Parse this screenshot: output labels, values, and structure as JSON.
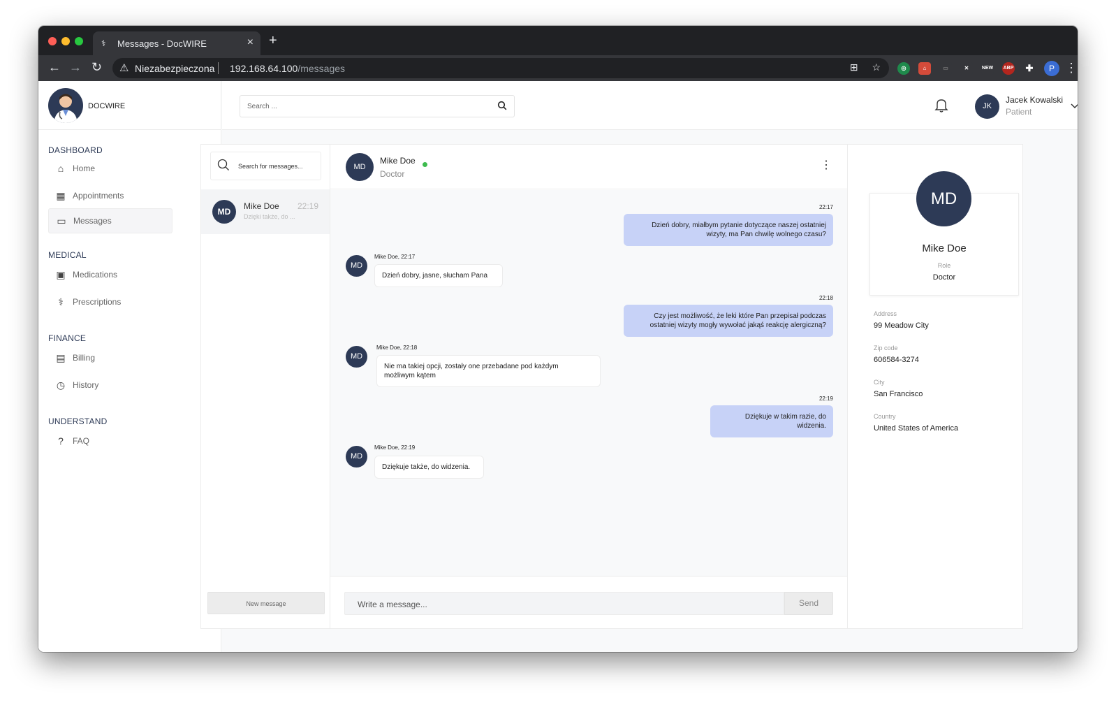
{
  "browser": {
    "tab_title": "Messages - DocWIRE",
    "insecure_label": "Niezabezpieczona",
    "url_host": "192.168.64.100",
    "url_path": "/messages",
    "profile_initial": "P",
    "ext_new": "NEW",
    "ext_abp": "ABP"
  },
  "sidebar": {
    "brand": "DOCWIRE",
    "sections": [
      {
        "title": "DASHBOARD",
        "items": [
          {
            "label": "Home",
            "icon": "home-icon"
          },
          {
            "label": "Appointments",
            "icon": "calendar-icon"
          },
          {
            "label": "Messages",
            "icon": "chat-icon",
            "active": true
          }
        ]
      },
      {
        "title": "MEDICAL",
        "items": [
          {
            "label": "Medications",
            "icon": "monitor-icon"
          },
          {
            "label": "Prescriptions",
            "icon": "pill-icon"
          }
        ]
      },
      {
        "title": "FINANCE",
        "items": [
          {
            "label": "Billing",
            "icon": "receipt-icon"
          },
          {
            "label": "History",
            "icon": "clock-icon"
          }
        ]
      },
      {
        "title": "UNDERSTAND",
        "items": [
          {
            "label": "FAQ",
            "icon": "question-icon"
          }
        ]
      }
    ]
  },
  "header": {
    "search_placeholder": "Search ...",
    "user_initials": "JK",
    "user_name": "Jacek Kowalski",
    "user_role": "Patient"
  },
  "conversations": {
    "search_placeholder": "Search for messages...",
    "items": [
      {
        "initials": "MD",
        "name": "Mike Doe",
        "time": "22:19",
        "preview": "Dzięki także, do ..."
      }
    ],
    "new_message_label": "New message"
  },
  "chat": {
    "initials": "MD",
    "name": "Mike Doe",
    "role": "Doctor",
    "messages": [
      {
        "dir": "out",
        "time": "22:17",
        "lines": [
          "Dzień dobry, miałbym pytanie dotyczące naszej ostatniej",
          "wizyty, ma Pan chwilę wolnego czasu?"
        ]
      },
      {
        "dir": "in",
        "meta": "Mike Doe, 22:17",
        "initials": "MD",
        "lines": [
          "Dzień dobry, jasne, słucham Pana"
        ]
      },
      {
        "dir": "out",
        "time": "22:18",
        "lines": [
          "Czy jest możliwość, że leki które Pan przepisał podczas",
          "ostatniej wizyty mogły wywołać jakąś reakcję alergiczną?"
        ]
      },
      {
        "dir": "in",
        "meta": "Mike Doe, 22:18",
        "initials": "MD",
        "lines": [
          "Nie ma takiej opcji, zostały one przebadane pod każdym",
          "możliwym kątem"
        ]
      },
      {
        "dir": "out",
        "time": "22:19",
        "lines": [
          "Dziękuje w takim razie, do",
          "widzenia."
        ]
      },
      {
        "dir": "in",
        "meta": "Mike Doe, 22:19",
        "initials": "MD",
        "lines": [
          "Dziękuje także, do widzenia."
        ]
      }
    ],
    "composer_placeholder": "Write a message...",
    "send_label": "Send"
  },
  "profile": {
    "initials": "MD",
    "name": "Mike Doe",
    "role_label": "Role",
    "role": "Doctor",
    "fields": [
      {
        "label": "Address",
        "value": "99 Meadow City"
      },
      {
        "label": "Zip code",
        "value": "606584-3274"
      },
      {
        "label": "City",
        "value": "San Francisco"
      },
      {
        "label": "Country",
        "value": "United States of America"
      }
    ]
  }
}
